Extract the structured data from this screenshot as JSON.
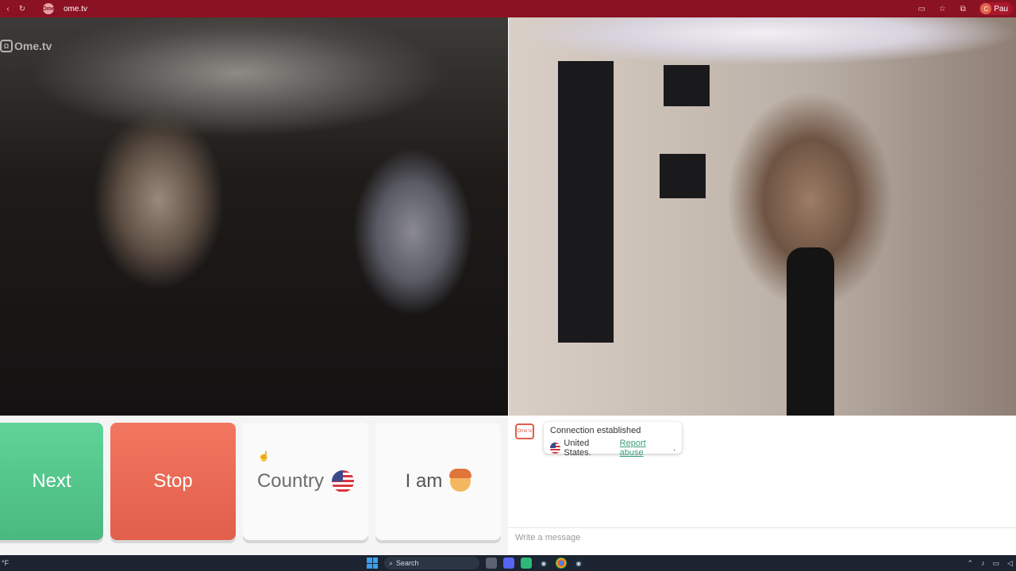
{
  "browser": {
    "url": "ome.tv",
    "favicon_label": "Ome",
    "profile_initial": "C",
    "profile_name": "Pau"
  },
  "video": {
    "logo_text": "Ome.tv",
    "logo_mark": "Ω"
  },
  "controls": {
    "next_label": "Next",
    "stop_label": "Stop",
    "country_label": "Country",
    "iam_label": "I am",
    "colors": {
      "next": "#4ab980",
      "stop": "#e15f4b"
    }
  },
  "chat": {
    "icon_text": "Ome tv",
    "status_text": "Connection established",
    "country_text": "United States.",
    "report_link": "Report abuse",
    "report_suffix": ".",
    "input_placeholder": "Write a message"
  },
  "taskbar": {
    "weather": "°F",
    "search_label": "Search"
  }
}
